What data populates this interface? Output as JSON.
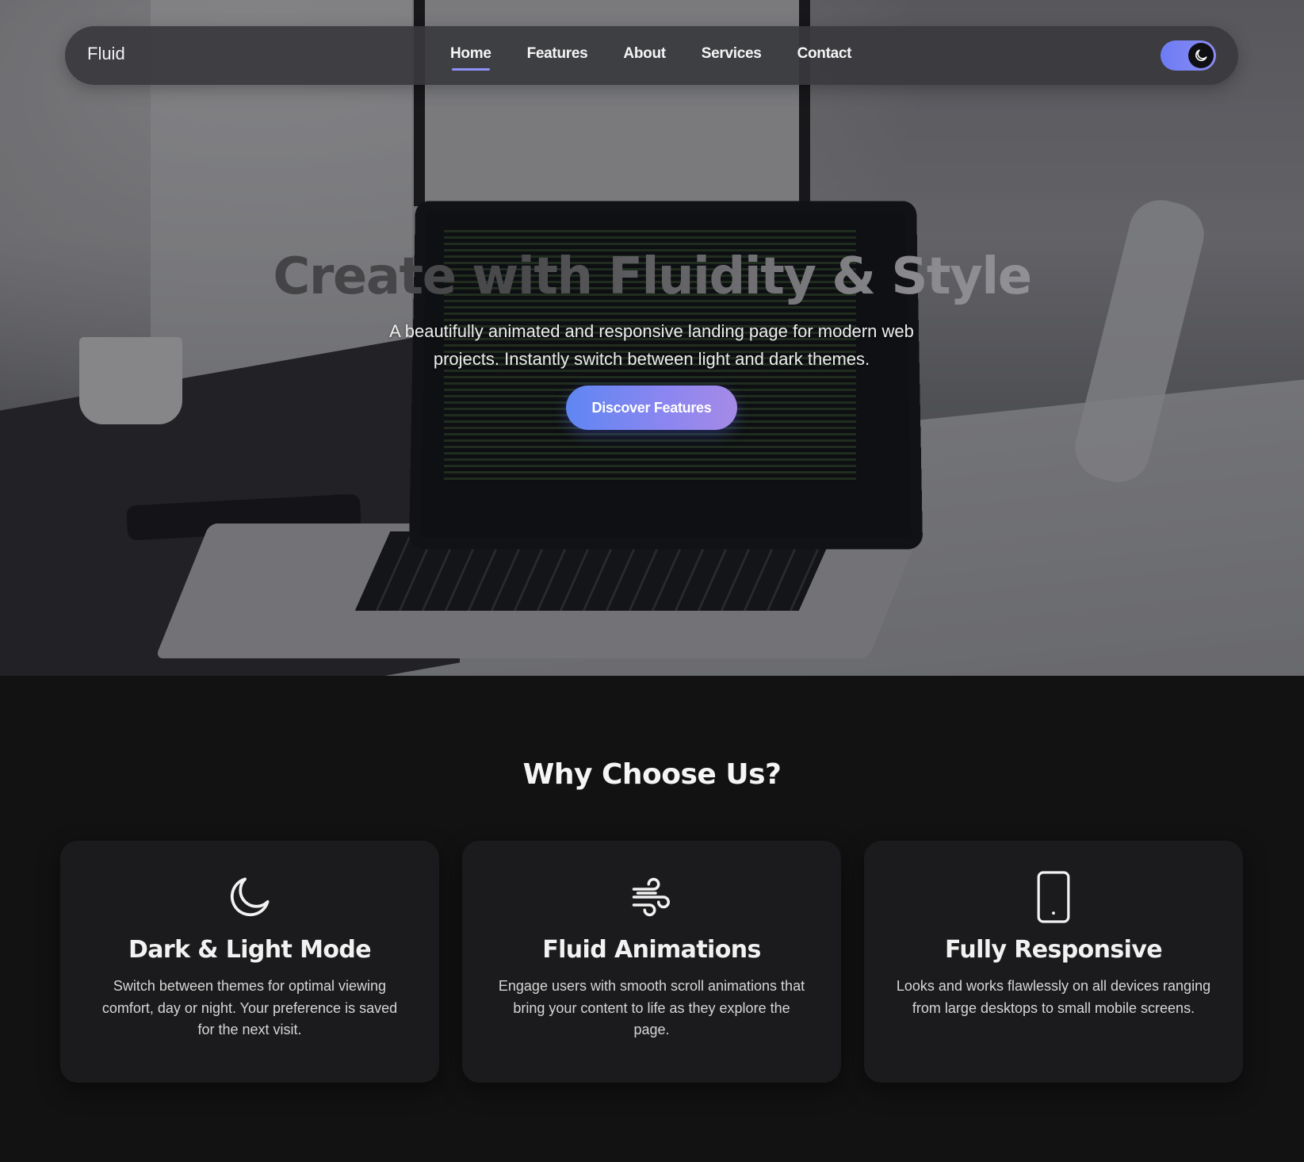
{
  "nav": {
    "brand": "Fluid",
    "links": [
      {
        "label": "Home",
        "active": true
      },
      {
        "label": "Features",
        "active": false
      },
      {
        "label": "About",
        "active": false
      },
      {
        "label": "Services",
        "active": false
      },
      {
        "label": "Contact",
        "active": false
      }
    ],
    "theme_toggle": {
      "state": "dark",
      "icon": "moon-icon",
      "accent": "#7b82f4"
    }
  },
  "hero": {
    "title": "Create with Fluidity & Style",
    "subtitle": "A beautifully animated and responsive landing page for modern web projects. Instantly switch between light and dark themes.",
    "cta_label": "Discover Features",
    "background_image": "desk-laptop-photo"
  },
  "features": {
    "title": "Why Choose Us?",
    "cards": [
      {
        "icon": "moon-icon",
        "title": "Dark & Light Mode",
        "text": "Switch between themes for optimal viewing comfort, day or night. Your preference is saved for the next visit."
      },
      {
        "icon": "wind-icon",
        "title": "Fluid Animations",
        "text": "Engage users with smooth scroll animations that bring your content to life as they explore the page."
      },
      {
        "icon": "tablet-icon",
        "title": "Fully Responsive",
        "text": "Looks and works flawlessly on all devices ranging from large desktops to small mobile screens."
      }
    ]
  },
  "colors": {
    "page_background": "#121212",
    "card_background": "#1b1b1d",
    "accent_gradient_start": "#5f86f2",
    "accent_gradient_end": "#a58ae6",
    "nav_underline": "#8f8ff6"
  }
}
